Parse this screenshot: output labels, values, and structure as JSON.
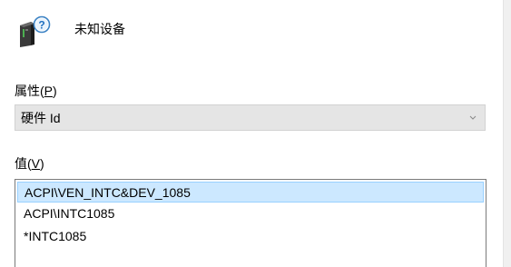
{
  "device": {
    "icon": "unknown-device-icon",
    "name": "未知设备"
  },
  "property": {
    "label": "属性(",
    "mnemonic": "P",
    "label_end": ")",
    "selected_value": "硬件 Id"
  },
  "values": {
    "label": "值(",
    "mnemonic": "V",
    "label_end": ")",
    "items": [
      "ACPI\\VEN_INTC&DEV_1085",
      "ACPI\\INTC1085",
      "*INTC1085"
    ]
  }
}
